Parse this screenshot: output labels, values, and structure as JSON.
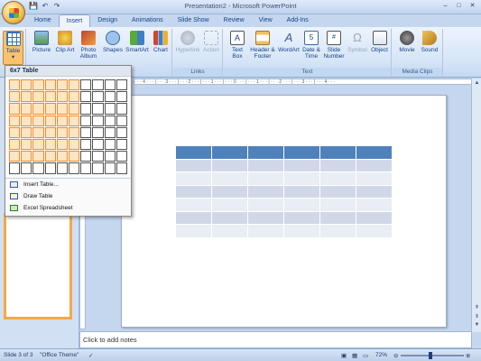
{
  "window": {
    "title": "Presentation2 - Microsoft PowerPoint",
    "controls": [
      "–",
      "□",
      "✕"
    ]
  },
  "qat": {
    "save": "💾",
    "undo": "↶",
    "redo": "↷"
  },
  "tabs": [
    "Home",
    "Insert",
    "Design",
    "Animations",
    "Slide Show",
    "Review",
    "View",
    "Add-Ins"
  ],
  "active_tab": "Insert",
  "ribbon": {
    "groups": [
      {
        "label": "",
        "buttons": [
          {
            "label": "Table",
            "icon": "table-icon",
            "pressed": true
          }
        ]
      },
      {
        "label": "",
        "buttons": [
          {
            "label": "Picture",
            "icon": "picture-icon"
          },
          {
            "label": "Clip Art",
            "icon": "clip-art-icon"
          },
          {
            "label": "Photo Album",
            "icon": "photo-album-icon"
          },
          {
            "label": "Shapes",
            "icon": "shapes-icon"
          },
          {
            "label": "SmartArt",
            "icon": "smartart-icon"
          },
          {
            "label": "Chart",
            "icon": "chart-icon"
          }
        ]
      },
      {
        "label": "Links",
        "buttons": [
          {
            "label": "Hyperlink",
            "icon": "hyperlink-icon",
            "disabled": true
          },
          {
            "label": "Action",
            "icon": "action-icon",
            "disabled": true
          }
        ]
      },
      {
        "label": "Text",
        "buttons": [
          {
            "label": "Text Box",
            "icon": "text-box-icon"
          },
          {
            "label": "Header & Footer",
            "icon": "header-footer-icon"
          },
          {
            "label": "WordArt",
            "icon": "wordart-icon"
          },
          {
            "label": "Date & Time",
            "icon": "date-time-icon"
          },
          {
            "label": "Slide Number",
            "icon": "slide-number-icon"
          },
          {
            "label": "Symbol",
            "icon": "symbol-icon",
            "disabled": true
          },
          {
            "label": "Object",
            "icon": "object-icon"
          }
        ]
      },
      {
        "label": "Media Clips",
        "buttons": [
          {
            "label": "Movie",
            "icon": "movie-icon"
          },
          {
            "label": "Sound",
            "icon": "sound-icon"
          }
        ]
      }
    ]
  },
  "table_dropdown": {
    "header": "6x7 Table",
    "grid_columns": 10,
    "grid_rows": 8,
    "selected_columns": 6,
    "selected_rows": 7,
    "menu_items": [
      "Insert Table...",
      "Draw Table",
      "Excel Spreadsheet"
    ]
  },
  "ruler_marks": "· · · 4 · · · | · · · 3 · · · | · · · 2 · · · | · · · 1 · · · | · · · 0 · · · | · · · 1 · · · | · · · 2 · · · | · · · 3 · · · | · · · 4 · · ·",
  "slide_table": {
    "columns": 6,
    "rows": 7,
    "header_color": "#4f81bd",
    "band_odd": "#d0d8e8",
    "band_even": "#e9edf4"
  },
  "notes": {
    "placeholder": "Click to add notes"
  },
  "status": {
    "slide": "Slide 3 of 3",
    "theme": "\"Office Theme\"",
    "zoom": "72%"
  },
  "colors": {
    "accent": "#f9c26b",
    "ribbon": "#d5e4f7",
    "table_header": "#4f81bd"
  }
}
